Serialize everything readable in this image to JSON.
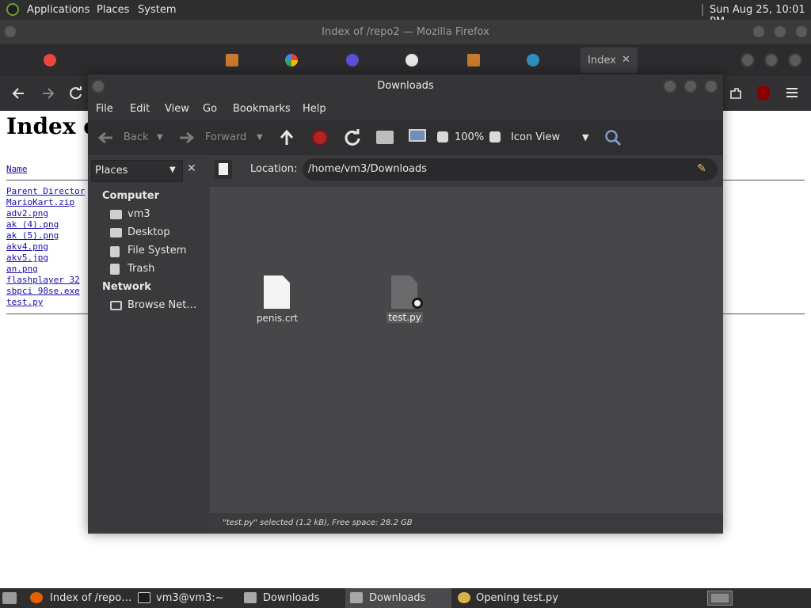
{
  "top_panel": {
    "applications": "Applications",
    "places": "Places",
    "system": "System",
    "clock": "Sun Aug 25, 10:01 PM"
  },
  "firefox": {
    "title": "Index of /repo2 — Mozilla Firefox",
    "active_tab": "Index",
    "tab_close": "✕",
    "page": {
      "heading": "Index of",
      "column_name": "Name",
      "entries": [
        "Parent Director",
        "MarioKart.zip",
        "adv2.png",
        "ak (4).png",
        "ak (5).png",
        "akv4.png",
        "akv5.jpg",
        "an.png",
        "flashplayer 32",
        "sbpci 98se.exe",
        "test.py"
      ]
    }
  },
  "file_manager": {
    "title": "Downloads",
    "menu": [
      "File",
      "Edit",
      "View",
      "Go",
      "Bookmarks",
      "Help"
    ],
    "toolbar": {
      "back": "Back",
      "forward": "Forward",
      "zoom": "100%",
      "view_mode": "Icon View"
    },
    "sidebar": {
      "pane_label": "Places",
      "computer_header": "Computer",
      "computer_items": [
        "vm3",
        "Desktop",
        "File System",
        "Trash"
      ],
      "network_header": "Network",
      "network_items": [
        "Browse Net…"
      ]
    },
    "location_label": "Location:",
    "location_value": "/home/vm3/Downloads",
    "files": [
      {
        "name": "penis.crt",
        "selected": false
      },
      {
        "name": "test.py",
        "selected": true
      }
    ],
    "status": "\"test.py\" selected (1.2 kB), Free space: 28.2 GB"
  },
  "taskbar": {
    "items": [
      "Index of /repo…",
      "vm3@vm3:~",
      "Downloads",
      "Downloads",
      "Opening test.py"
    ]
  },
  "colors": {
    "panel_bg": "#2e2e2e",
    "fm_bg": "#474749",
    "record_red": "#b32424",
    "link_blue": "#1a0dab"
  }
}
